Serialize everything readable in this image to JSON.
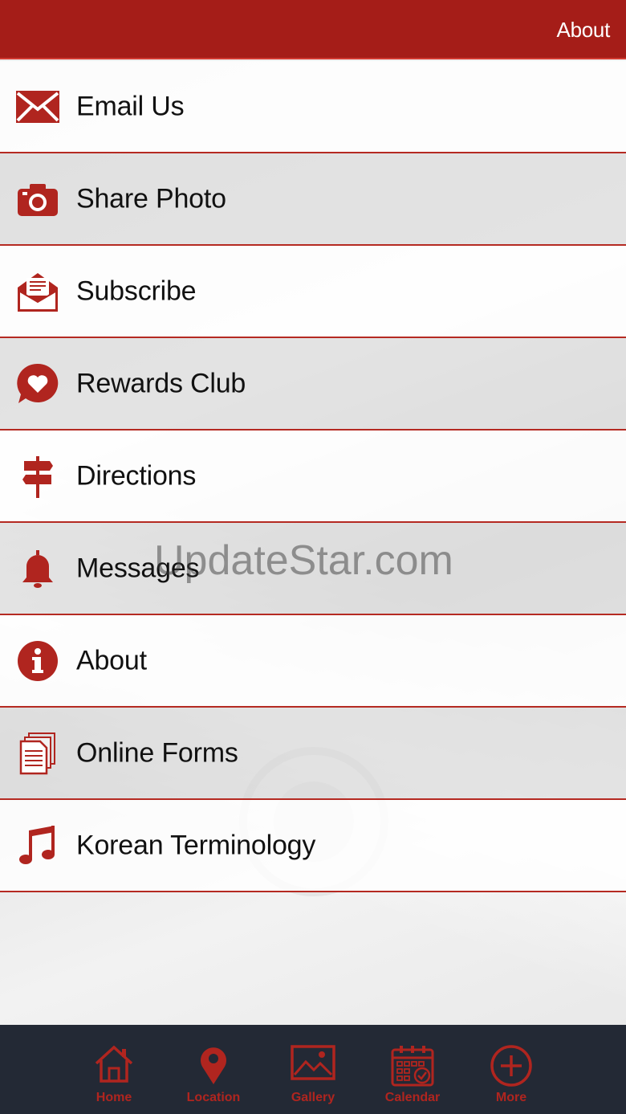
{
  "header": {
    "title": "About"
  },
  "menu": {
    "items": [
      {
        "label": "Email Us",
        "icon": "envelope-icon"
      },
      {
        "label": "Share Photo",
        "icon": "camera-icon"
      },
      {
        "label": "Subscribe",
        "icon": "newsletter-icon"
      },
      {
        "label": "Rewards Club",
        "icon": "heart-bubble-icon"
      },
      {
        "label": "Directions",
        "icon": "signpost-icon"
      },
      {
        "label": "Messages",
        "icon": "bell-icon"
      },
      {
        "label": "About",
        "icon": "info-icon"
      },
      {
        "label": "Online Forms",
        "icon": "documents-icon"
      },
      {
        "label": "Korean Terminology",
        "icon": "music-note-icon"
      }
    ]
  },
  "watermark": {
    "text": "UpdateStar.com"
  },
  "tabbar": {
    "tabs": [
      {
        "label": "Home",
        "icon": "home-icon"
      },
      {
        "label": "Location",
        "icon": "location-pin-icon"
      },
      {
        "label": "Gallery",
        "icon": "gallery-icon"
      },
      {
        "label": "Calendar",
        "icon": "calendar-icon"
      },
      {
        "label": "More",
        "icon": "plus-circle-icon"
      }
    ]
  },
  "colors": {
    "brand_red": "#a51d18",
    "icon_red": "#b0251f",
    "tabbar_bg": "#232935",
    "divider": "#b52a22"
  }
}
